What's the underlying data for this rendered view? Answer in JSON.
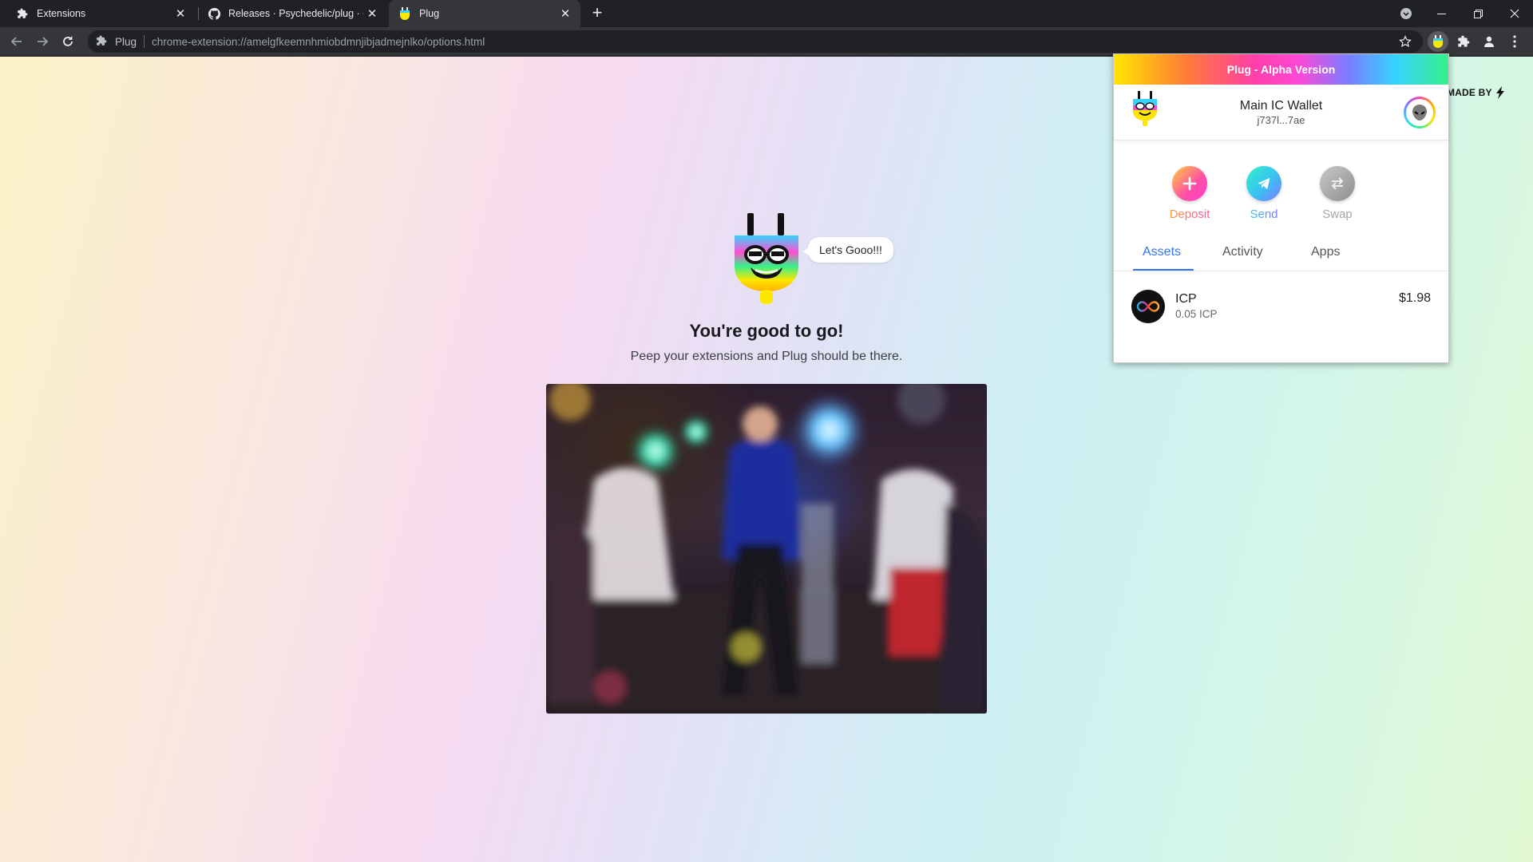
{
  "browser": {
    "tabs": [
      {
        "title": "Extensions",
        "icon": "puzzle-icon",
        "active": false
      },
      {
        "title": "Releases · Psychedelic/plug · Git",
        "icon": "github-icon",
        "active": false
      },
      {
        "title": "Plug",
        "icon": "plug-icon",
        "active": true
      }
    ],
    "new_tab_label": "+",
    "omnibox": {
      "site_chip": "Plug",
      "url": "chrome-extension://amelgfkeemnhmiobdmnjibjadmejnlko/options.html"
    }
  },
  "page": {
    "made_by": "MADE BY",
    "speech_bubble": "Let's Gooo!!!",
    "headline": "You're good to go!",
    "subline": "Peep your extensions and Plug should be there."
  },
  "popup": {
    "title": "Plug - Alpha Version",
    "wallet": {
      "name": "Main IC Wallet",
      "id": "j737l...7ae"
    },
    "actions": [
      {
        "label": "Deposit",
        "icon": "plus-icon",
        "color": "#ff5fa2"
      },
      {
        "label": "Send",
        "icon": "send-icon",
        "color": "#36c6f0"
      },
      {
        "label": "Swap",
        "icon": "swap-icon",
        "color": "#a6a6a6"
      }
    ],
    "tabs": [
      {
        "label": "Assets",
        "active": true
      },
      {
        "label": "Activity",
        "active": false
      },
      {
        "label": "Apps",
        "active": false
      }
    ],
    "assets": [
      {
        "symbol": "ICP",
        "amount": "0.05 ICP",
        "value": "$1.98"
      }
    ]
  },
  "colors": {
    "accent_blue": "#3574f0",
    "chrome_dark": "#202124",
    "chrome_toolbar": "#35363a"
  }
}
